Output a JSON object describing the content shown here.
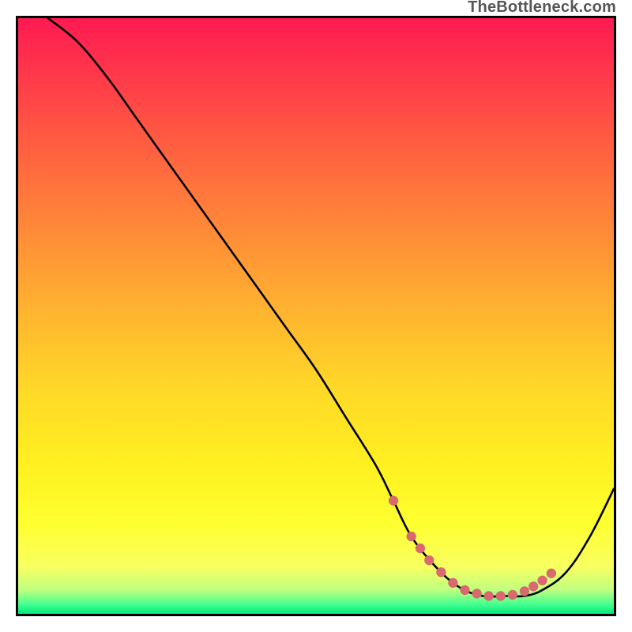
{
  "watermark": "TheBottleneck.com",
  "chart_data": {
    "type": "line",
    "title": "",
    "xlabel": "",
    "ylabel": "",
    "xlim": [
      0,
      100
    ],
    "ylim": [
      0,
      100
    ],
    "grid": false,
    "legend": false,
    "series": [
      {
        "name": "bottleneck-curve",
        "x": [
          5,
          10,
          15,
          20,
          25,
          30,
          35,
          40,
          45,
          50,
          55,
          60,
          63,
          66,
          70,
          74,
          78,
          82,
          85,
          88,
          92,
          96,
          100
        ],
        "y": [
          100,
          96,
          90,
          83,
          76,
          69,
          62,
          55,
          48,
          41,
          33,
          25,
          19,
          13,
          8,
          4.5,
          3,
          3,
          3,
          4,
          7,
          13,
          21
        ]
      }
    ],
    "highlight_points": {
      "name": "trough-markers",
      "color": "#d9686f",
      "x": [
        63,
        66,
        67.5,
        69,
        71,
        73,
        75,
        77,
        79,
        81,
        83,
        85,
        86.5,
        88,
        89.5
      ],
      "y": [
        19,
        13,
        11,
        9,
        7,
        5.2,
        4,
        3.4,
        3,
        3,
        3.2,
        3.8,
        4.6,
        5.6,
        6.8
      ]
    },
    "gradient_stops": [
      {
        "pos": 0,
        "color": "#ff1a52"
      },
      {
        "pos": 22,
        "color": "#ff6040"
      },
      {
        "pos": 48,
        "color": "#ffb030"
      },
      {
        "pos": 75,
        "color": "#fff020"
      },
      {
        "pos": 92,
        "color": "#f8ff60"
      },
      {
        "pos": 100,
        "color": "#00e878"
      }
    ]
  }
}
